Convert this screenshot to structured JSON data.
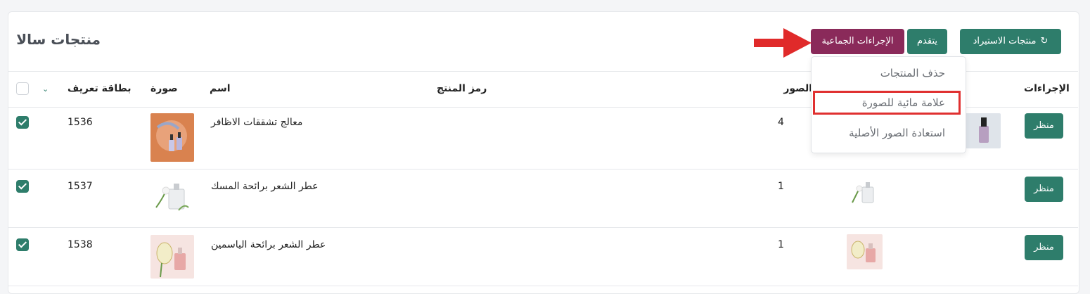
{
  "header": {
    "title": "منتجات سالا",
    "import_button": "منتجات الاستيراد",
    "advance_button": "يتقدم",
    "bulk_button": "الإجراءات الجماعية"
  },
  "dropdown": {
    "items": [
      "حذف المنتجات",
      "علامة مائية للصورة",
      "استعادة الصور الأصلية"
    ],
    "highlighted_index": 1
  },
  "table": {
    "columns": {
      "id": "بطاقة تعريف",
      "image": "صورة",
      "name": "اسم",
      "code": "رمز المنتج",
      "images": "الصور",
      "actions": "الإجراءات"
    },
    "rows": [
      {
        "checked": true,
        "id": "1536",
        "name": "معالج تشققات الاظافر",
        "code": "",
        "image_count": "4",
        "view": "منظر"
      },
      {
        "checked": true,
        "id": "1537",
        "name": "عطر الشعر برائحة المسك",
        "code": "",
        "image_count": "1",
        "view": "منظر"
      },
      {
        "checked": true,
        "id": "1538",
        "name": "عطر الشعر برائحة الياسمين",
        "code": "",
        "image_count": "1",
        "view": "منظر"
      }
    ]
  },
  "colors": {
    "primary": "#2e7d6b",
    "bulk": "#8a2a5a",
    "highlight": "#e03030"
  },
  "icons": [
    "refresh-icon",
    "chevron-down-icon",
    "arrow-right-icon"
  ]
}
